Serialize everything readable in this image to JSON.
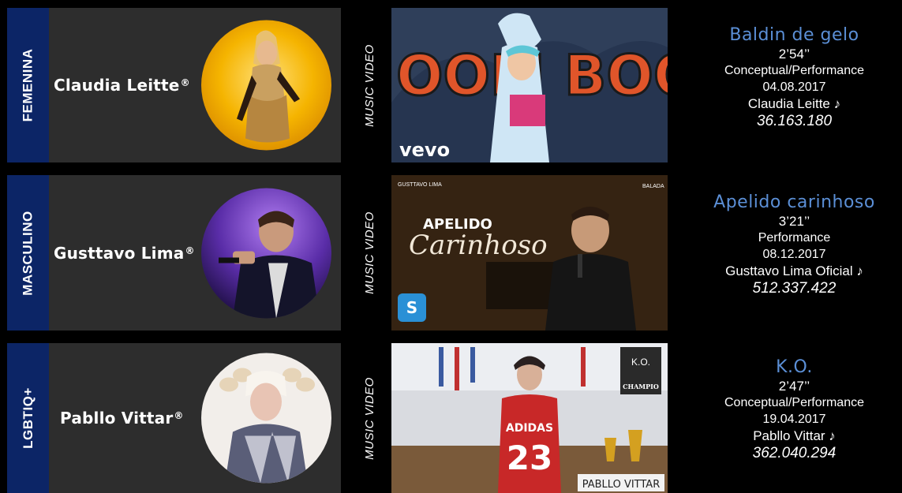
{
  "rows": [
    {
      "category": "FEMENINA",
      "artist": "Claudia Leitte",
      "reg": "®",
      "video_label": "MUSIC VIDEO",
      "thumb_text": "OOM BOO",
      "thumb_logo": "vevo",
      "song": "Baldin de gelo",
      "duration": "2’54’’",
      "type": "Conceptual/Performance",
      "date": "04.08.2017",
      "channel": "Claudia Leitte ♪",
      "views": "36.163.180"
    },
    {
      "category": "MASCULINO",
      "artist": "Gusttavo Lima",
      "reg": "®",
      "video_label": "MUSIC VIDEO",
      "thumb_text_top": "APELIDO",
      "thumb_text_main": "Carinhoso",
      "thumb_corner_left": "GUSTTAVO LIMA",
      "thumb_corner_right": "BALADA",
      "song": "Apelido carinhoso",
      "duration": "3’21’’",
      "type": "Performance",
      "date": "08.12.2017",
      "channel": "Gusttavo Lima Oficial ♪",
      "views": "512.337.422"
    },
    {
      "category": "LGBTIQ+",
      "artist": "Pabllo Vittar",
      "reg": "®",
      "video_label": "MUSIC VIDEO",
      "thumb_jersey": "ADIDAS",
      "thumb_number": "23",
      "thumb_sign": "PABLLO VITTAR",
      "thumb_poster": "K.O.",
      "thumb_poster2": "CHAMPIO",
      "song": "K.O.",
      "duration": "2’47’’",
      "type": "Conceptual/Performance",
      "date": "19.04.2017",
      "channel": "Pabllo Vittar ♪",
      "views": "362.040.294"
    }
  ],
  "colors": {
    "category_tab": "#0c2566",
    "panel": "#2d2d2d",
    "song_title": "#5b8fd6",
    "background": "#000000"
  }
}
